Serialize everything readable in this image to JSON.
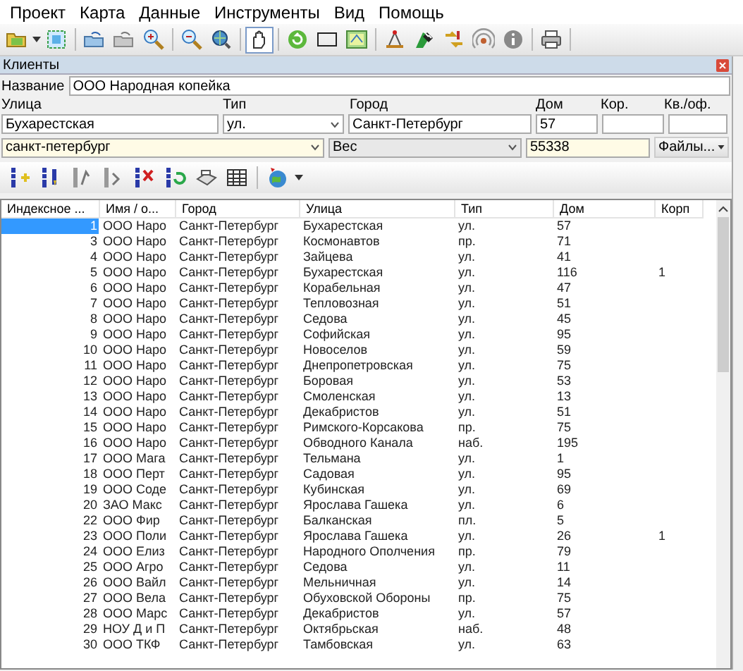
{
  "menu": [
    "Проект",
    "Карта",
    "Данные",
    "Инструменты",
    "Вид",
    "Помощь"
  ],
  "toolbar": [
    {
      "pressed": false
    },
    {
      "pressed": false
    },
    {
      "pressed": false
    },
    {
      "pressed": false
    },
    {
      "pressed": false
    },
    {
      "pressed": false
    },
    {
      "pressed": false
    },
    {
      "pressed": true
    },
    {
      "pressed": false
    },
    {
      "pressed": false
    },
    {
      "pressed": false
    },
    {
      "pressed": false
    },
    {
      "pressed": false
    },
    {
      "pressed": false
    },
    {
      "pressed": false
    },
    {
      "pressed": false
    },
    {
      "pressed": false
    }
  ],
  "panel": {
    "title": "Клиенты",
    "name_label": "Название",
    "name_value": "ООО Народная копейка",
    "address_labels": [
      "Улица",
      "Тип",
      "Город",
      "Дом",
      "Кор.",
      "Кв./оф."
    ],
    "street": "Бухарестская",
    "type": "ул.",
    "city": "Санкт-Петербург",
    "house": "57",
    "region": "санкт-петербург",
    "weight_field": "Вес",
    "weight_value": "55338",
    "files_button": "Файлы..."
  },
  "table": {
    "columns": [
      "Индексное ...",
      "Имя / о...",
      "Город",
      "Улица",
      "Тип",
      "Дом",
      "Корп"
    ],
    "rows": [
      {
        "cells": [
          "1",
          "ООО Наро",
          "Санкт-Петербург",
          "Бухарестская",
          "ул.",
          "57",
          ""
        ],
        "selected": true
      },
      {
        "cells": [
          "3",
          "ООО Наро",
          "Санкт-Петербург",
          "Космонавтов",
          "пр.",
          "71",
          ""
        ],
        "selected": false
      },
      {
        "cells": [
          "4",
          "ООО Наро",
          "Санкт-Петербург",
          "Зайцева",
          "ул.",
          "41",
          ""
        ],
        "selected": false
      },
      {
        "cells": [
          "5",
          "ООО Наро",
          "Санкт-Петербург",
          "Бухарестская",
          "ул.",
          "116",
          "1"
        ],
        "selected": false
      },
      {
        "cells": [
          "6",
          "ООО Наро",
          "Санкт-Петербург",
          "Корабельная",
          "ул.",
          "47",
          ""
        ],
        "selected": false
      },
      {
        "cells": [
          "7",
          "ООО Наро",
          "Санкт-Петербург",
          "Тепловозная",
          "ул.",
          "51",
          ""
        ],
        "selected": false
      },
      {
        "cells": [
          "8",
          "ООО Наро",
          "Санкт-Петербург",
          "Седова",
          "ул.",
          "45",
          ""
        ],
        "selected": false
      },
      {
        "cells": [
          "9",
          "ООО Наро",
          "Санкт-Петербург",
          "Софийская",
          "ул.",
          "95",
          ""
        ],
        "selected": false
      },
      {
        "cells": [
          "10",
          "ООО Наро",
          "Санкт-Петербург",
          "Новоселов",
          "ул.",
          "59",
          ""
        ],
        "selected": false
      },
      {
        "cells": [
          "11",
          "ООО Наро",
          "Санкт-Петербург",
          "Днепропетровская",
          "ул.",
          "75",
          ""
        ],
        "selected": false
      },
      {
        "cells": [
          "12",
          "ООО Наро",
          "Санкт-Петербург",
          "Боровая",
          "ул.",
          "53",
          ""
        ],
        "selected": false
      },
      {
        "cells": [
          "13",
          "ООО Наро",
          "Санкт-Петербург",
          "Смоленская",
          "ул.",
          "13",
          ""
        ],
        "selected": false
      },
      {
        "cells": [
          "14",
          "ООО Наро",
          "Санкт-Петербург",
          "Декабристов",
          "ул.",
          "51",
          ""
        ],
        "selected": false
      },
      {
        "cells": [
          "15",
          "ООО Наро",
          "Санкт-Петербург",
          "Римского-Корсакова",
          "пр.",
          "75",
          ""
        ],
        "selected": false
      },
      {
        "cells": [
          "16",
          "ООО Наро",
          "Санкт-Петербург",
          "Обводного Канала",
          "наб.",
          "195",
          ""
        ],
        "selected": false
      },
      {
        "cells": [
          "17",
          "ООО Мага",
          "Санкт-Петербург",
          "Тельмана",
          "ул.",
          "1",
          ""
        ],
        "selected": false
      },
      {
        "cells": [
          "18",
          "ООО Перт",
          "Санкт-Петербург",
          "Садовая",
          "ул.",
          "95",
          ""
        ],
        "selected": false
      },
      {
        "cells": [
          "19",
          "ООО Соде",
          "Санкт-Петербург",
          "Кубинская",
          "ул.",
          "69",
          ""
        ],
        "selected": false
      },
      {
        "cells": [
          "20",
          "ЗАО Макс",
          "Санкт-Петербург",
          "Ярослава Гашека",
          "ул.",
          "6",
          ""
        ],
        "selected": false
      },
      {
        "cells": [
          "22",
          "ООО Фир",
          "Санкт-Петербург",
          "Балканская",
          "пл.",
          "5",
          ""
        ],
        "selected": false
      },
      {
        "cells": [
          "23",
          "ООО Поли",
          "Санкт-Петербург",
          "Ярослава Гашека",
          "ул.",
          "26",
          "1"
        ],
        "selected": false
      },
      {
        "cells": [
          "24",
          "ООО Елиз",
          "Санкт-Петербург",
          "Народного Ополчения",
          "пр.",
          "79",
          ""
        ],
        "selected": false
      },
      {
        "cells": [
          "25",
          "ООО Агро",
          "Санкт-Петербург",
          "Седова",
          "ул.",
          "11",
          ""
        ],
        "selected": false
      },
      {
        "cells": [
          "26",
          "ООО Вайл",
          "Санкт-Петербург",
          "Мельничная",
          "ул.",
          "14",
          ""
        ],
        "selected": false
      },
      {
        "cells": [
          "27",
          "ООО Вела",
          "Санкт-Петербург",
          "Обуховской Обороны",
          "пр.",
          "75",
          ""
        ],
        "selected": false
      },
      {
        "cells": [
          "28",
          "ООО Марс",
          "Санкт-Петербург",
          "Декабристов",
          "ул.",
          "57",
          ""
        ],
        "selected": false
      },
      {
        "cells": [
          "29",
          "НОУ Д и П",
          "Санкт-Петербург",
          "Октябрьская",
          "наб.",
          "48",
          ""
        ],
        "selected": false
      },
      {
        "cells": [
          "30",
          "ООО ТКФ",
          "Санкт-Петербург",
          "Тамбовская",
          "ул.",
          "63",
          ""
        ],
        "selected": false
      }
    ]
  }
}
